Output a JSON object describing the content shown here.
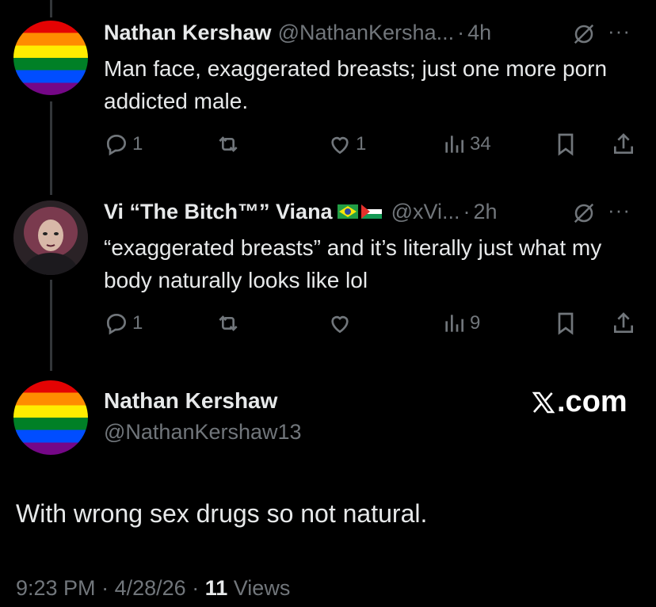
{
  "tweets": [
    {
      "name": "Nathan Kershaw",
      "handle": "@NathanKersha...",
      "time": "4h",
      "text": "Man face, exaggerated breasts; just one more porn addicted male.",
      "replies": "1",
      "likes": "1",
      "views": "34"
    },
    {
      "name": "Vi “The Bitch™” Viana",
      "handle": "@xVi...",
      "time": "2h",
      "text": "“exaggerated breasts” and it’s literally just what my body naturally looks like lol",
      "replies": "1",
      "likes": "",
      "views": "9"
    }
  ],
  "main": {
    "name": "Nathan Kershaw",
    "handle": "@NathanKershaw13",
    "brand": ".com",
    "text": "With wrong sex drugs so not natural.",
    "time": "9:23 PM",
    "date": "4/28/26",
    "views_count": "11",
    "views_label": "Views"
  },
  "separator": "·",
  "more_glyph": "···",
  "icons": [
    "reply-icon",
    "repost-icon",
    "like-icon",
    "views-icon",
    "bookmark-icon",
    "share-icon",
    "grok-icon",
    "more-icon",
    "x-logo-icon",
    "brazil-flag-icon",
    "palestine-flag-icon"
  ],
  "colors": {
    "background": "#000000",
    "text": "#e7e9ea",
    "muted": "#71767b",
    "line": "#333639"
  }
}
